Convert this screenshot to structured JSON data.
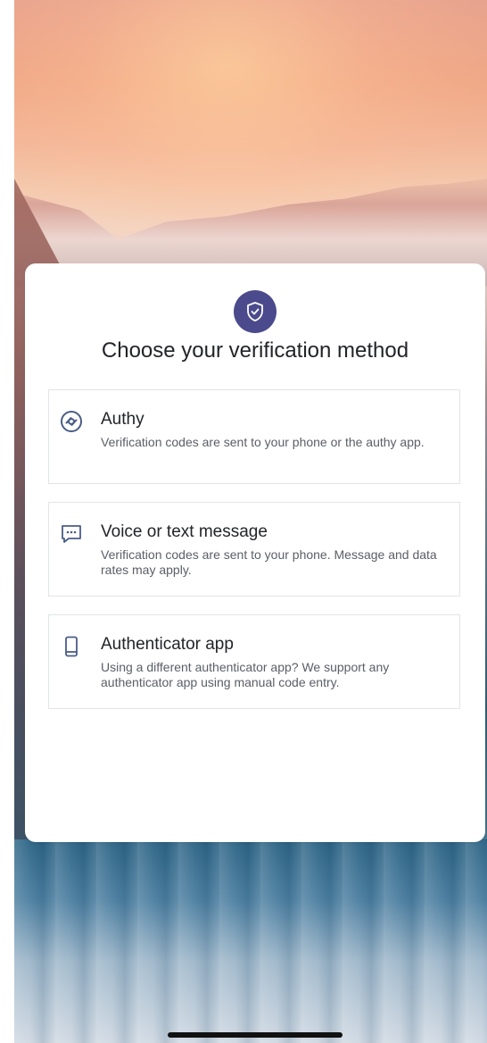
{
  "colors": {
    "accent": "#4b4a8c",
    "icon": "#4a5d86",
    "title_text": "#222428",
    "description_text": "#5b5e66",
    "border": "#e3e4e8"
  },
  "card": {
    "header_icon": "shield-check-icon",
    "title": "Choose your verification method"
  },
  "options": [
    {
      "icon": "authy-icon",
      "title": "Authy",
      "description": "Verification codes are sent to your phone or the authy app."
    },
    {
      "icon": "message-icon",
      "title": "Voice or text message",
      "description": "Verification codes are sent to your phone. Message and data rates may apply."
    },
    {
      "icon": "phone-icon",
      "title": "Authenticator app",
      "description": "Using a different authenticator app? We support any authenticator app using manual code entry."
    }
  ]
}
